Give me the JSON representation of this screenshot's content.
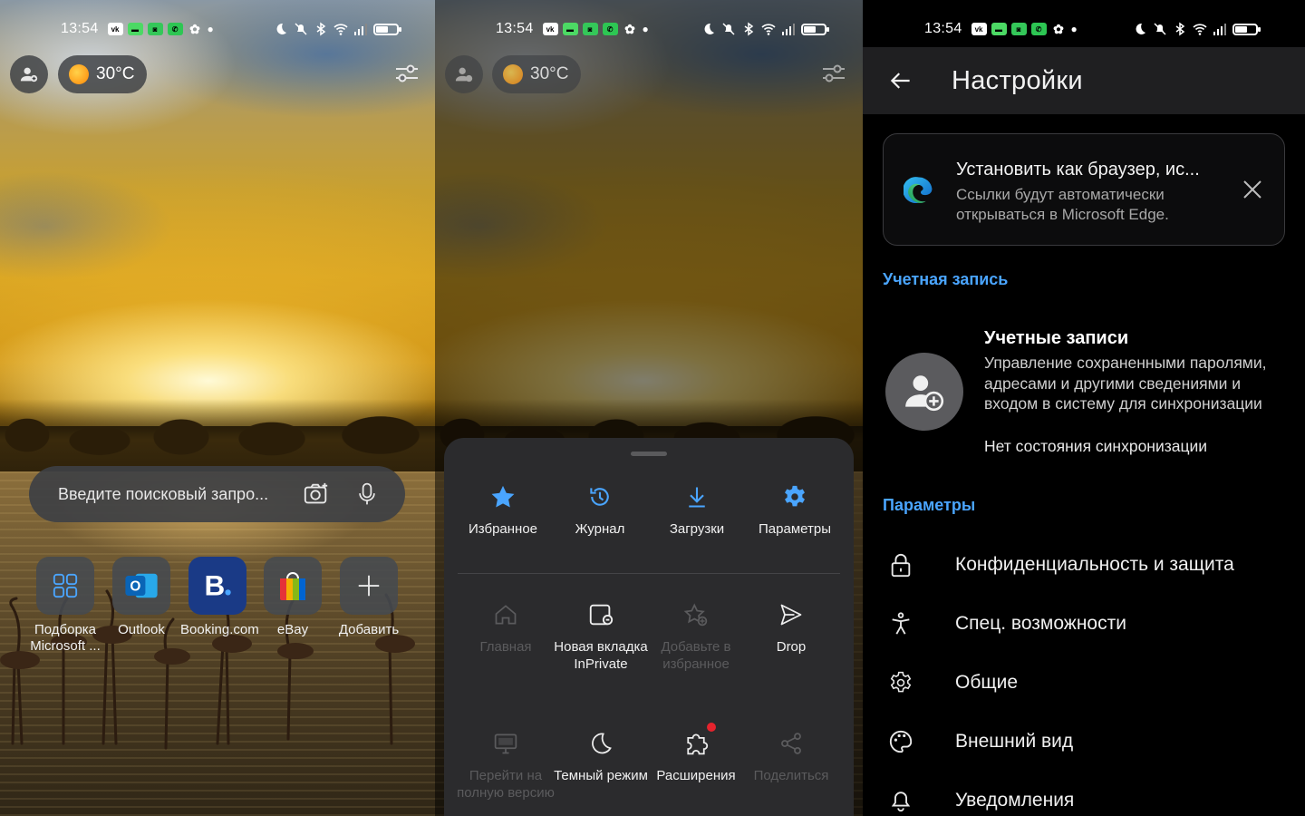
{
  "status_bar": {
    "time": "13:54",
    "battery_level": 0.55
  },
  "home": {
    "temperature": "30°C",
    "search_placeholder": "Введите поисковый запро...",
    "tiles": [
      {
        "label": "Подборка Microsoft ...",
        "icon": "microsoft-grid-icon"
      },
      {
        "label": "Outlook",
        "icon": "outlook-icon"
      },
      {
        "label": "Booking.com",
        "icon": "booking-icon"
      },
      {
        "label": "eBay",
        "icon": "ebay-icon"
      },
      {
        "label": "Добавить",
        "icon": "plus-icon"
      }
    ]
  },
  "menu": {
    "temperature": "30°C",
    "top_items": [
      {
        "label": "Избранное",
        "icon": "star-icon"
      },
      {
        "label": "Журнал",
        "icon": "history-icon"
      },
      {
        "label": "Загрузки",
        "icon": "download-icon"
      },
      {
        "label": "Параметры",
        "icon": "gear-icon"
      }
    ],
    "grid_items": [
      {
        "label": "Главная",
        "icon": "home-icon",
        "enabled": false
      },
      {
        "label": "Новая вкладка InPrivate",
        "icon": "inprivate-tab-icon",
        "enabled": true
      },
      {
        "label": "Добавьте в избранное",
        "icon": "add-favorite-icon",
        "enabled": false
      },
      {
        "label": "Drop",
        "icon": "send-icon",
        "enabled": true
      },
      {
        "label": "Перейти на полную версию",
        "icon": "desktop-icon",
        "enabled": false
      },
      {
        "label": "Темный режим",
        "icon": "moon-icon",
        "enabled": true
      },
      {
        "label": "Расширения",
        "icon": "puzzle-icon",
        "enabled": true,
        "badge": true
      },
      {
        "label": "Поделиться",
        "icon": "share-icon",
        "enabled": false
      }
    ]
  },
  "settings": {
    "title": "Настройки",
    "default_card": {
      "title": "Установить как браузер, ис...",
      "description": "Ссылки будут автоматически открываться в Microsoft Edge."
    },
    "account_section": "Учетная запись",
    "accounts": {
      "title": "Учетные записи",
      "description": "Управление сохраненными паролями, адресами и другими сведениями и входом в систему для синхронизации",
      "sync_status": "Нет состояния синхронизации"
    },
    "params_section": "Параметры",
    "rows": [
      {
        "label": "Конфиденциальность и защита",
        "icon": "lock-icon"
      },
      {
        "label": "Спец. возможности",
        "icon": "accessibility-icon"
      },
      {
        "label": "Общие",
        "icon": "gear-icon"
      },
      {
        "label": "Внешний вид",
        "icon": "palette-icon"
      },
      {
        "label": "Уведомления",
        "icon": "bell-icon"
      }
    ]
  },
  "colors": {
    "accent_blue": "#4aa5ff",
    "sheet_bg": "#2b2b2d",
    "badge_red": "#e5232d"
  }
}
